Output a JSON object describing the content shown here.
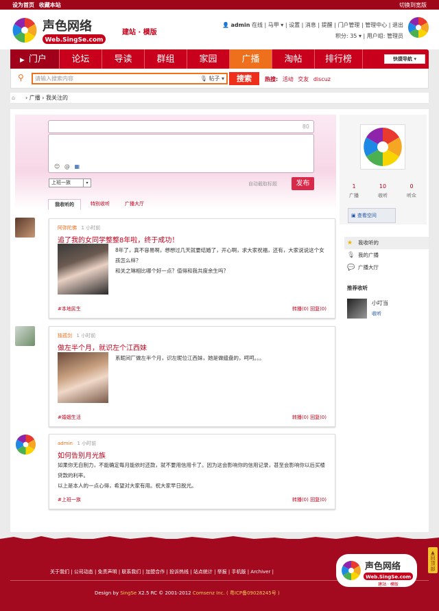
{
  "topbar": {
    "set_home": "设为首页",
    "bookmark": "收藏本站",
    "switch_wide": "切换到宽版"
  },
  "header": {
    "site_name": "声色网络",
    "site_url": "Web.SingSe.com",
    "slogan": "建站 · 模版",
    "user": {
      "name": "admin",
      "status": "在线",
      "horse": "马甲",
      "links": [
        "设置",
        "消息",
        "提醒",
        "门户管理",
        "管理中心",
        "退出"
      ],
      "points": "积分: 35",
      "group": "用户组: 管理员"
    }
  },
  "nav": {
    "items": [
      "门户",
      "论坛",
      "导读",
      "群组",
      "家园",
      "广播",
      "淘帖",
      "排行榜"
    ],
    "active_index": 5,
    "quick_nav": "快捷导航"
  },
  "search": {
    "placeholder": "请输入搜索内容",
    "category": "帖子",
    "button": "搜索",
    "hot_label": "热搜:",
    "hot_items": [
      "活动",
      "交友",
      "discuz"
    ]
  },
  "breadcrumb": {
    "items": [
      "广播",
      "我关注的"
    ]
  },
  "post": {
    "count": "80",
    "icons": [
      "😊",
      "@",
      "▦"
    ],
    "select_value": "上班一族",
    "auto_tag": "自动截取标题",
    "submit": "发布",
    "tabs": [
      "我收听的",
      "特别收听",
      "广播大厅"
    ]
  },
  "feeds": [
    {
      "author": "阿弥陀佛",
      "time": "1 小时前",
      "title": "追了我的女同学整整8年啦，终于成功！",
      "body": [
        "8年了，真不容易啊，想想过几天就要结婚了，开心啊，求大家祝福，还有，大家说说这个女孩怎么样？",
        "和关之琳相比哪个好一点？值得和我共度余生吗？"
      ],
      "tag": "#本地民生",
      "actions": "转播(0)  回复(0)"
    },
    {
      "author": "独孤剑",
      "time": "1 小时前",
      "title": "做左半个月，就识左个江西妹",
      "body": [
        "系昵间厂做左半个月，识左昵位江西妹，她是做缝盘的，呵呵。。。"
      ],
      "tag": "#婚姻生活",
      "actions": "转播(0)  回复(0)"
    },
    {
      "author": "admin",
      "time": "1 小时前",
      "title": "如何告别月光族",
      "body": [
        "如果你无自制力，不能确定每月能依时还款，就不要用信用卡了。因为这会影响你的信用记录，甚至会影响你以后买楼贷款的利率。",
        "以上是本人的一点心得，希望对大家有用。祝大家早日脱光。"
      ],
      "tag": "#上班一族",
      "actions": "转播(0)  回复(0)"
    }
  ],
  "sidebar": {
    "stats": [
      {
        "n": "1",
        "l": "广播"
      },
      {
        "n": "10",
        "l": "收听"
      },
      {
        "n": "0",
        "l": "听众"
      }
    ],
    "visit_space": "查看空间",
    "menu": [
      "我收听的",
      "我的广播",
      "广播大厅"
    ],
    "recommend_title": "推荐收听",
    "recommend_user": "小叮当",
    "recommend_action": "收听"
  },
  "footer": {
    "links": "关于我们 | 公司动态 | 免责声明 | 联系我们 | 加盟合作 | 投诉热线 | 站点统计 | 举报 | 手机版 | Archiver |",
    "copy_prefix": "Design by ",
    "copy_brand": "SingSe",
    "copy_mid": " X2.5 RC © 2001-2012 ",
    "copy_company": "Comsenz Inc.",
    "copy_icp": " ( 粤ICP备09028245号 )",
    "to_top": "回顶部"
  },
  "colors": {
    "brand": "#c9001b",
    "accent": "#ee6f1c",
    "footer": "#a30a1f"
  }
}
